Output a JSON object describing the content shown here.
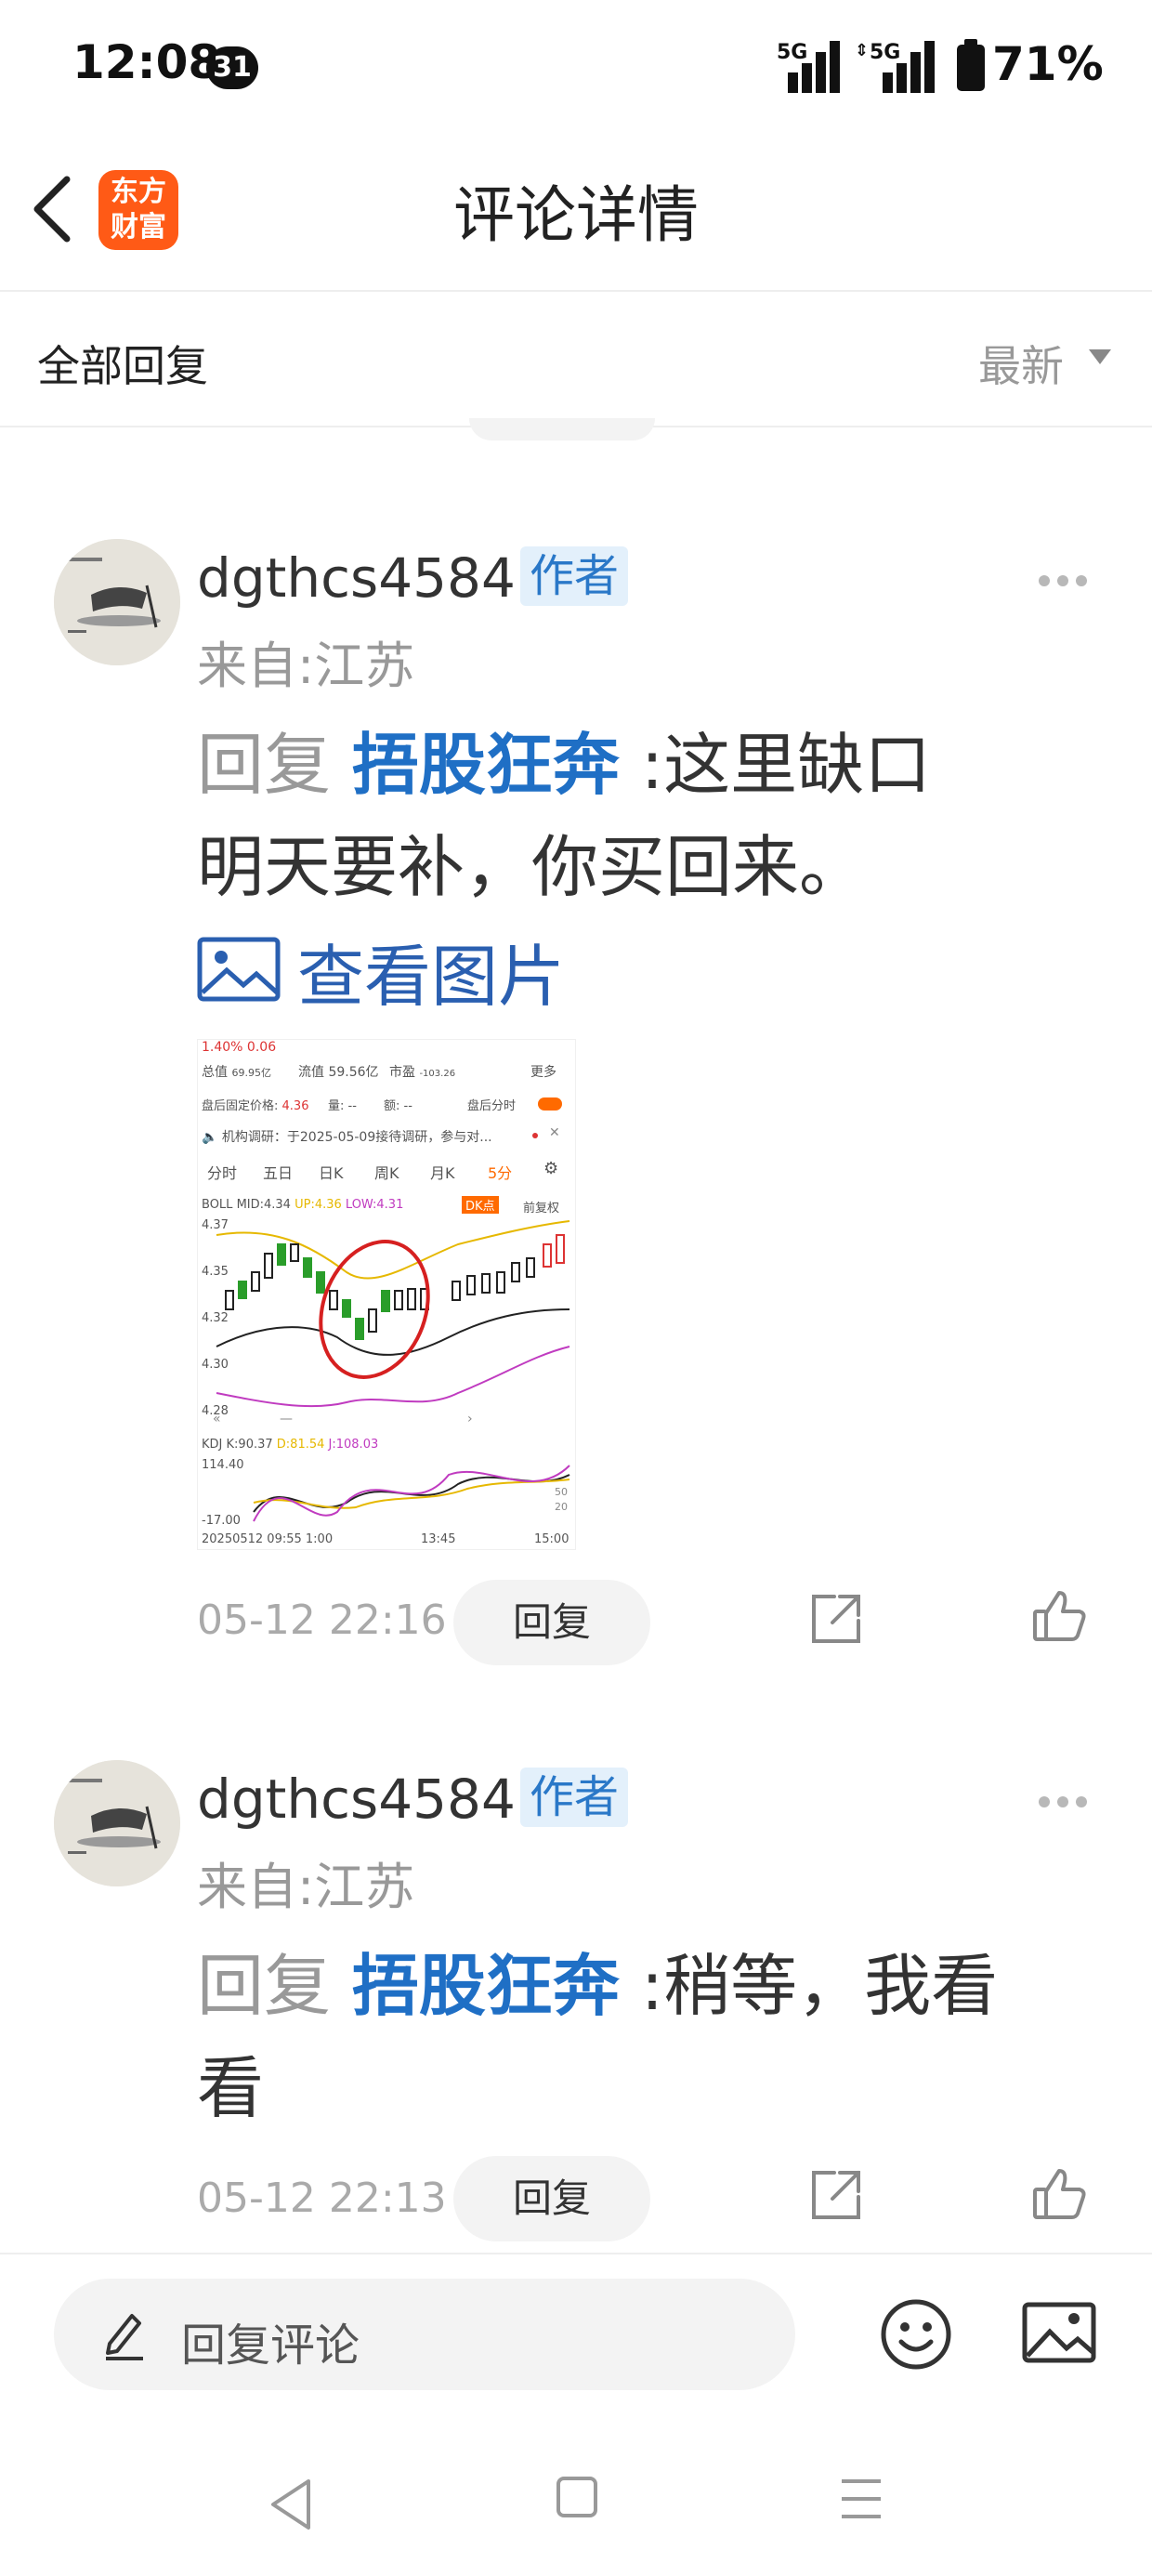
{
  "status_bar": {
    "time": "12:08",
    "notification_count": "31",
    "signal1_label": "5G",
    "signal2_label": "5G",
    "battery": "71%"
  },
  "header": {
    "logo_text_line1": "东方",
    "logo_text_line2": "财富",
    "title": "评论详情"
  },
  "filter": {
    "label": "全部回复",
    "sort_label": "最新"
  },
  "comments": [
    {
      "username": "dgthcs4584",
      "badge": "作者",
      "location": "来自:江苏",
      "reply_prefix": "回复",
      "mention": "捂股狂奔",
      "separator": ":",
      "text_line1": "这里缺口",
      "text_line2": "明天要补，你买回来。",
      "view_image_label": "查看图片",
      "timestamp": "05-12 22:16",
      "reply_button": "回复"
    },
    {
      "username": "dgthcs4584",
      "badge": "作者",
      "location": "来自:江苏",
      "reply_prefix": "回复",
      "mention": "捂股狂奔",
      "separator": ":",
      "text_line1": "稍等，我看",
      "text_line2": "看",
      "timestamp": "05-12 22:13",
      "reply_button": "回复"
    }
  ],
  "thumbnail": {
    "top_row": "1.40%  0.06",
    "mktcap": "总值",
    "mktcap_val": "69.95亿",
    "float": "流值",
    "float_val": "59.56亿",
    "pe": "市盈",
    "pe_val": "-103.26",
    "more": "更多",
    "afterhours": "盘后固定价格:",
    "afterhours_val": "4.36",
    "vol": "量: --",
    "amt": "额: --",
    "after_timeshare": "盘后分时",
    "news": "机构调研：于2025-05-09接待调研，参与对...",
    "tabs": [
      "分时",
      "五日",
      "日K",
      "周K",
      "月K",
      "5分"
    ],
    "boll": "BOLL",
    "boll_mid": "MID:4.34",
    "boll_up": "UP:4.36",
    "boll_low": "LOW:4.31",
    "dk": "DK点",
    "fq": "前复权",
    "y1": "4.37",
    "y2": "4.35",
    "y3": "4.32",
    "y4": "4.30",
    "y5": "4.28",
    "kdj": "KDJ",
    "kdj_k": "K:90.37",
    "kdj_d": "D:81.54",
    "kdj_j": "J:108.03",
    "kdj_y1": "114.40",
    "kdj_y2": "-17.00",
    "kdj_r1": "50",
    "kdj_r2": "20",
    "x1": "20250512 09:55",
    "x2": "1:00",
    "x3": "13:45",
    "x4": "15:00"
  },
  "bottom": {
    "input_placeholder": "回复评论"
  },
  "colors": {
    "accent_blue": "#1f6fc5",
    "logo_orange": "#ff5a16",
    "badge_bg": "#e3f0fb"
  }
}
